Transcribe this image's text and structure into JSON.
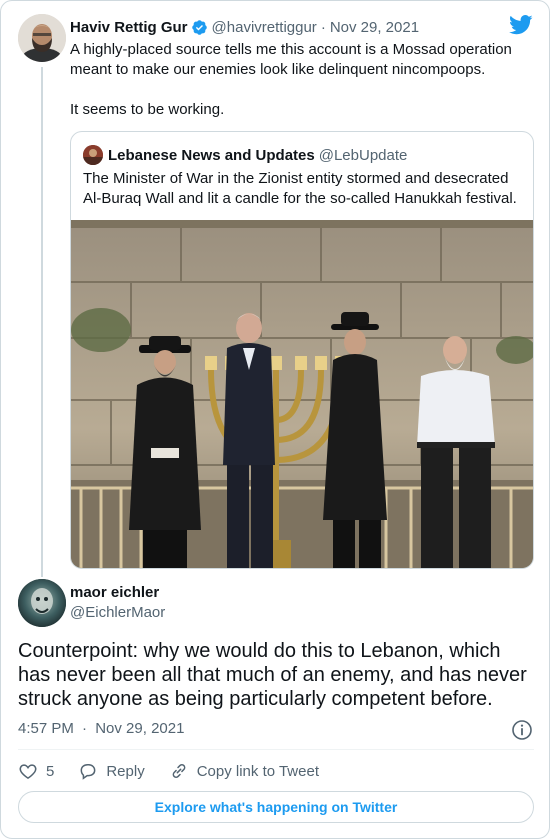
{
  "tweet": {
    "author_name": "Haviv Rettig Gur",
    "author_handle": "@havivrettiggur",
    "separator": "·",
    "date": "Nov 29, 2021",
    "text_line1": "A highly-placed source tells me this account is a Mossad operation meant to make our enemies look like delinquent nincompoops.",
    "text_line2": "It seems to be working."
  },
  "quote": {
    "author_name": "Lebanese News and Updates",
    "author_handle": "@LebUpdate",
    "text": "The Minister of War in the Zionist entity stormed and desecrated Al-Buraq Wall and lit a candle for the so-called Hanukkah festival."
  },
  "reply": {
    "author_name": "maor eichler",
    "author_handle": "@EichlerMaor",
    "text": "Counterpoint: why we would do this to Lebanon, which has never been all that much of an enemy, and has never struck anyone as being particularly competent before.",
    "time": "4:57 PM",
    "separator": "·",
    "date": "Nov 29, 2021"
  },
  "actions": {
    "like_count": "5",
    "reply_label": "Reply",
    "copy_label": "Copy link to Tweet"
  },
  "footer": {
    "explore_label": "Explore what's happening on Twitter"
  },
  "colors": {
    "twitter_blue": "#1d9bf0",
    "text_primary": "#0f1419",
    "text_secondary": "#536471",
    "border": "#cfd9de"
  },
  "icons": [
    "twitter-bird-icon",
    "verified-badge-icon",
    "info-icon",
    "heart-icon",
    "reply-bubble-icon",
    "link-icon"
  ]
}
